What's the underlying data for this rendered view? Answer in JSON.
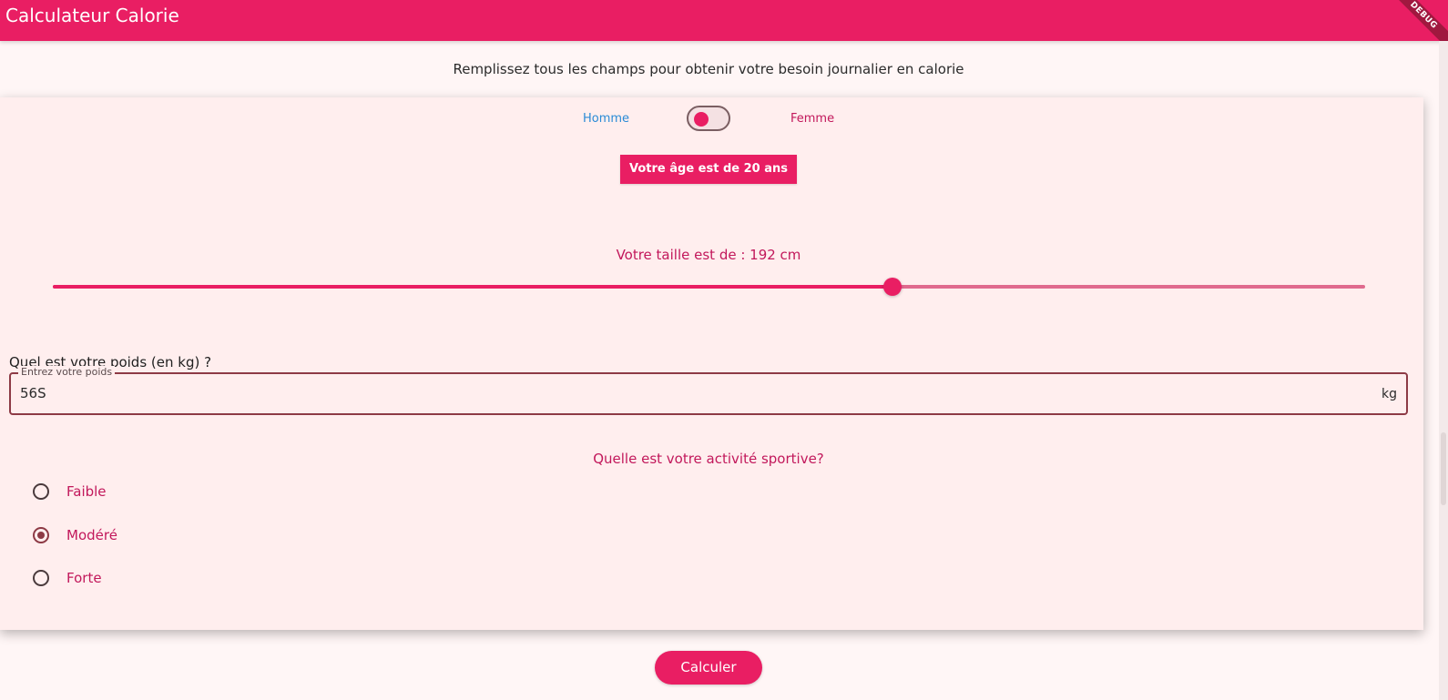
{
  "app": {
    "title": "Calculateur Calorie",
    "debug_banner": "DEBUG"
  },
  "intro": {
    "text": "Remplissez tous les champs pour obtenir votre besoin journalier en calorie"
  },
  "gender": {
    "left_label": "Homme",
    "right_label": "Femme",
    "selected": "Femme"
  },
  "age": {
    "button_label": "Votre âge est de 20 ans"
  },
  "height": {
    "label": "Votre taille est de : 192 cm",
    "slider_fraction": 0.64
  },
  "weight": {
    "question": "Quel est votre poids (en kg) ?",
    "field_label": "Entrez votre poids",
    "value": "56S",
    "suffix": "kg"
  },
  "activity": {
    "question": "Quelle est votre activité sportive?",
    "options": [
      {
        "label": "Faible",
        "selected": false
      },
      {
        "label": "Modéré",
        "selected": true
      },
      {
        "label": "Forte",
        "selected": false
      }
    ]
  },
  "actions": {
    "calculate_label": "Calculer"
  },
  "colors": {
    "primary": "#e91e63",
    "background": "#fff6f6",
    "card": "#ffeeee",
    "radio_selected": "#8d3a45",
    "homme_label": "#2a8bd6"
  }
}
